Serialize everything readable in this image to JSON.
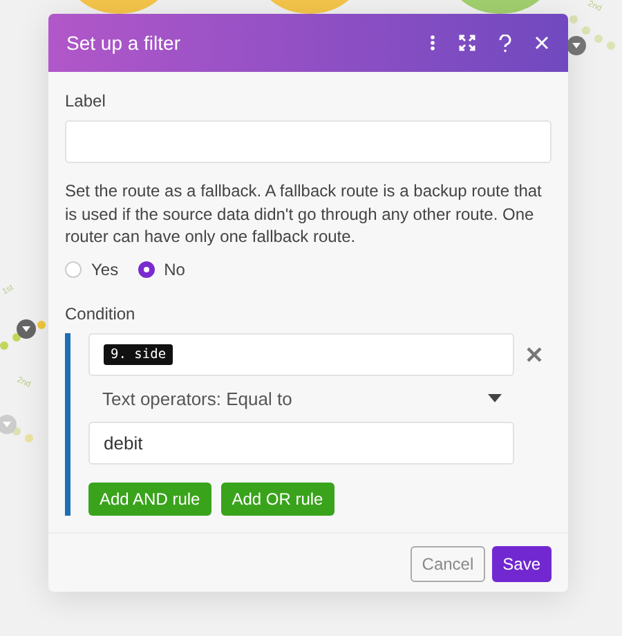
{
  "canvas": {
    "route_labels": [
      "1st",
      "2nd",
      "2nd"
    ]
  },
  "dialog": {
    "title": "Set up a filter",
    "label_field": {
      "label": "Label"
    },
    "fallback": {
      "description": "Set the route as a fallback. A fallback route is a backup route that is used if the source data didn't go through any other route. One router can have only one fallback route.",
      "options": [
        {
          "label": "Yes",
          "selected": false
        },
        {
          "label": "No",
          "selected": true
        }
      ]
    },
    "condition": {
      "label": "Condition",
      "operand": "9. side",
      "operator": "Text operators: Equal to",
      "value": "debit",
      "rule_buttons": [
        "Add AND rule",
        "Add OR rule"
      ]
    },
    "buttons": [
      {
        "label": "Cancel",
        "kind": "secondary"
      },
      {
        "label": "Save",
        "kind": "primary"
      }
    ]
  }
}
